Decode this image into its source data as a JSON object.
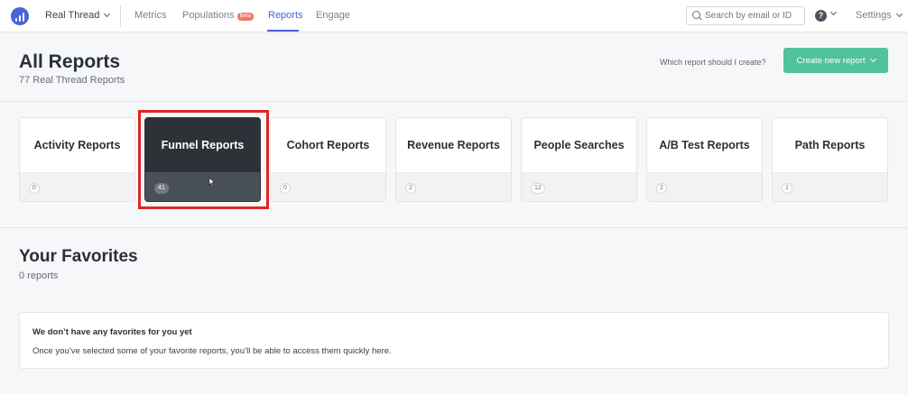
{
  "nav": {
    "app_name": "Real Thread",
    "items": [
      {
        "label": "Metrics"
      },
      {
        "label": "Populations",
        "badge": "Beta"
      },
      {
        "label": "Reports",
        "active": true
      },
      {
        "label": "Engage"
      }
    ],
    "search_placeholder": "Search by email or ID",
    "help_icon": "?",
    "settings_label": "Settings"
  },
  "header": {
    "title": "All Reports",
    "subtitle": "77 Real Thread Reports",
    "help_link": "Which report should I create?",
    "create_button": "Create new report"
  },
  "report_types": [
    {
      "label": "Activity Reports",
      "count": "0"
    },
    {
      "label": "Funnel Reports",
      "count": "41",
      "active": true
    },
    {
      "label": "Cohort Reports",
      "count": "0"
    },
    {
      "label": "Revenue Reports",
      "count": "2"
    },
    {
      "label": "People Searches",
      "count": "12"
    },
    {
      "label": "A/B Test Reports",
      "count": "2"
    },
    {
      "label": "Path Reports",
      "count": "1"
    }
  ],
  "favorites": {
    "title": "Your Favorites",
    "subtitle": "0 reports",
    "empty_heading": "We don’t have any favorites for you yet",
    "empty_body": "Once you’ve selected some of your favorite reports, you’ll be able to access them quickly here."
  },
  "colors": {
    "accent": "#4a63d8",
    "create_button": "#52c29a",
    "active_card": "#2d3238",
    "highlight": "#e02424"
  }
}
